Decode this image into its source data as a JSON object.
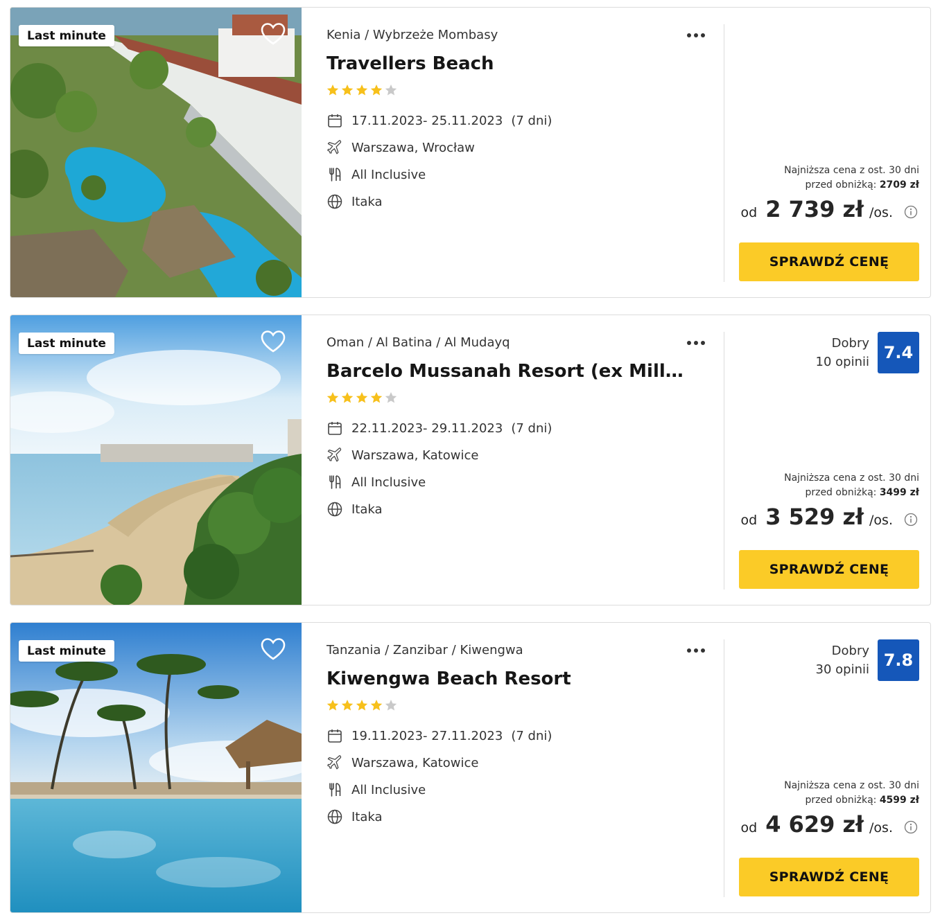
{
  "colors": {
    "accent_button": "#fbcb27",
    "score_badge": "#1557b9",
    "star_filled": "#f7c01b",
    "star_empty": "#c9c9c9"
  },
  "offers": [
    {
      "badge": "Last minute",
      "location": "Kenia / Wybrzeże Mombasy",
      "name": "Travellers Beach",
      "stars": 4,
      "dates": "17.11.2023- 25.11.2023",
      "duration": "(7 dni)",
      "departure": "Warszawa, Wrocław",
      "board": "All Inclusive",
      "operator": "Itaka",
      "rating_label": "",
      "rating_count": "",
      "rating_score": "",
      "lowest_line1": "Najniższa cena z ost. 30 dni",
      "lowest_prefix": "przed obniżką: ",
      "lowest_value": "2709 zł",
      "price_from": "od",
      "price": "2 739 zł",
      "price_unit": "/os.",
      "cta": "SPRAWDŹ CENĘ",
      "icons": [
        "heart-icon",
        "more-icon",
        "calendar-icon",
        "plane-icon",
        "cutlery-icon",
        "globe-icon",
        "info-icon"
      ]
    },
    {
      "badge": "Last minute",
      "location": "Oman / Al Batina / Al Mudayq",
      "name": "Barcelo Mussanah Resort (ex Millenium Resort Mussanah)",
      "stars": 4,
      "dates": "22.11.2023- 29.11.2023",
      "duration": "(7 dni)",
      "departure": "Warszawa, Katowice",
      "board": "All Inclusive",
      "operator": "Itaka",
      "rating_label": "Dobry",
      "rating_count": "10 opinii",
      "rating_score": "7.4",
      "lowest_line1": "Najniższa cena z ost. 30 dni",
      "lowest_prefix": "przed obniżką: ",
      "lowest_value": "3499 zł",
      "price_from": "od",
      "price": "3 529 zł",
      "price_unit": "/os.",
      "cta": "SPRAWDŹ CENĘ",
      "icons": [
        "heart-icon",
        "more-icon",
        "calendar-icon",
        "plane-icon",
        "cutlery-icon",
        "globe-icon",
        "info-icon"
      ]
    },
    {
      "badge": "Last minute",
      "location": "Tanzania / Zanzibar / Kiwengwa",
      "name": "Kiwengwa Beach Resort",
      "stars": 4,
      "dates": "19.11.2023- 27.11.2023",
      "duration": "(7 dni)",
      "departure": "Warszawa, Katowice",
      "board": "All Inclusive",
      "operator": "Itaka",
      "rating_label": "Dobry",
      "rating_count": "30 opinii",
      "rating_score": "7.8",
      "lowest_line1": "Najniższa cena z ost. 30 dni",
      "lowest_prefix": "przed obniżką: ",
      "lowest_value": "4599 zł",
      "price_from": "od",
      "price": "4 629 zł",
      "price_unit": "/os.",
      "cta": "SPRAWDŹ CENĘ",
      "icons": [
        "heart-icon",
        "more-icon",
        "calendar-icon",
        "plane-icon",
        "cutlery-icon",
        "globe-icon",
        "info-icon"
      ]
    }
  ]
}
